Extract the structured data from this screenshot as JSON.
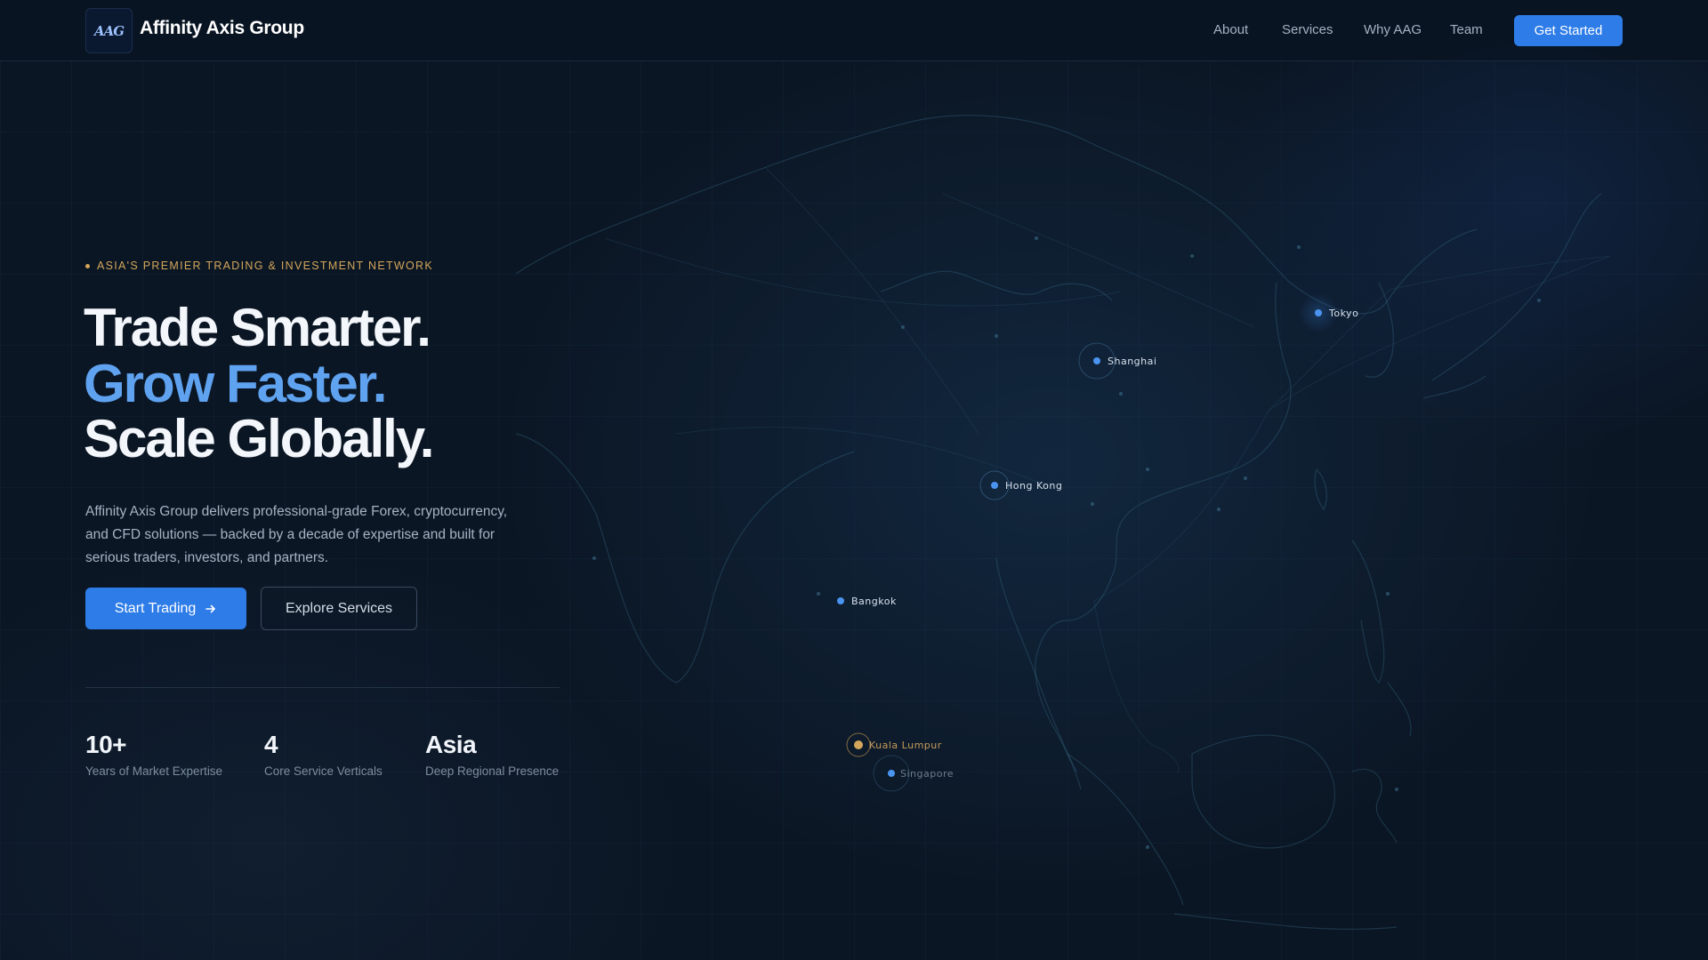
{
  "nav": {
    "brand": "Affinity Axis Group",
    "logo_text": "AAG",
    "links": [
      "About",
      "Services",
      "Why AAG",
      "Team"
    ],
    "cta": "Get Started"
  },
  "hero": {
    "eyebrow": "ASIA'S PREMIER TRADING & INVESTMENT NETWORK",
    "headline": [
      "Trade Smarter.",
      "Grow Faster.",
      "Scale Globally."
    ],
    "description": "Affinity Axis Group delivers professional-grade Forex, cryptocurrency, and CFD solutions — backed by a decade of expertise and built for serious traders, investors, and partners.",
    "primary_button": "Start Trading",
    "primary_button_icon": "arrow-right-icon",
    "secondary_button": "Explore Services"
  },
  "stats": [
    {
      "value": "10+",
      "label": "Years of Market Expertise"
    },
    {
      "value": "4",
      "label": "Core Service Verticals"
    },
    {
      "value": "Asia",
      "label": "Deep Regional Presence"
    }
  ],
  "map": {
    "cities": [
      "Tokyo",
      "Shanghai",
      "Hong Kong",
      "Bangkok",
      "Kuala Lumpur",
      "Singapore"
    ],
    "highlighted_city": "Kuala Lumpur"
  },
  "colors": {
    "background": "#0b1624",
    "accent_blue": "#2d7ce8",
    "headline_blue": "#5fa2f0",
    "gold": "#d3a65a"
  }
}
